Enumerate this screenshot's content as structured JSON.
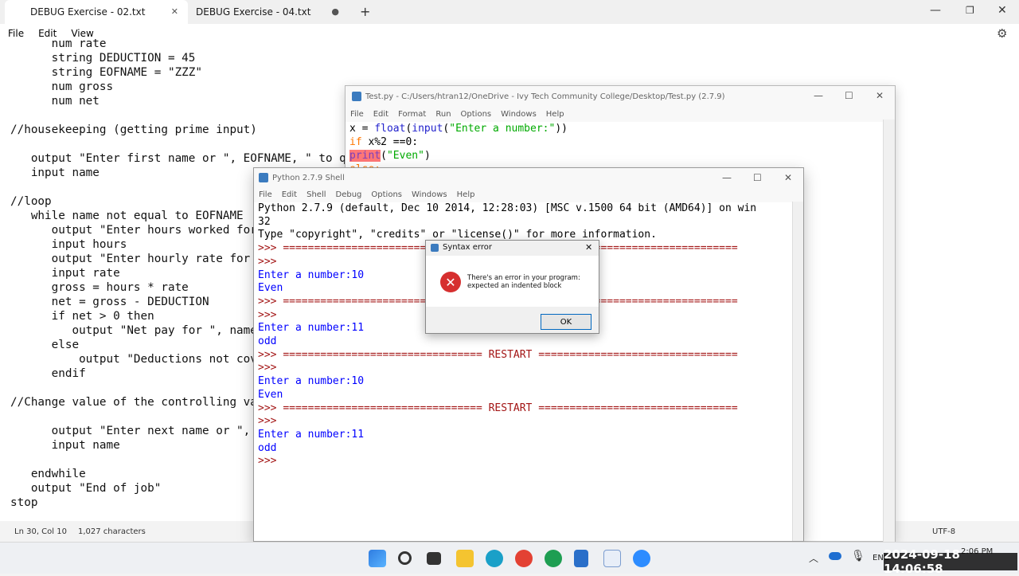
{
  "notepad": {
    "tabs": [
      {
        "label": "DEBUG Exercise - 02.txt"
      },
      {
        "label": "DEBUG Exercise - 04.txt"
      }
    ],
    "menu": [
      "File",
      "Edit",
      "View"
    ],
    "code": "      num rate\n      string DEDUCTION = 45\n      string EOFNAME = \"ZZZ\"\n      num gross\n      num net\n\n//housekeeping (getting prime input)\n\n   output \"Enter first name or \", EOFNAME, \" to q\n   input name\n\n//loop\n   while name not equal to EOFNAME\n      output \"Enter hours worked for\n      input hours\n      output \"Enter hourly rate for\n      input rate\n      gross = hours * rate\n      net = gross - DEDUCTION\n      if net > 0 then\n         output \"Net pay for \", name\n      else\n          output \"Deductions not cov\n      endif\n\n//Change value of the controlling va\n\n      output \"Enter next name or \",\n      input name\n\n   endwhile\n   output \"End of job\"\nstop",
    "status": {
      "position": "Ln 30, Col 10",
      "chars": "1,027 characters",
      "encoding": "UTF-8"
    }
  },
  "editor": {
    "title": "Test.py - C:/Users/htran12/OneDrive - Ivy Tech Community College/Desktop/Test.py (2.7.9)",
    "menu": [
      "File",
      "Edit",
      "Format",
      "Run",
      "Options",
      "Windows",
      "Help"
    ],
    "lines": {
      "l1a": "x = ",
      "l1b": "float",
      "l1c": "(",
      "l1d": "input",
      "l1e": "(",
      "l1f": "\"Enter a number:\"",
      "l1g": "))",
      "l2a": "if",
      "l2b": " x%2 ==0:",
      "l3a": "print",
      "l3b": "(",
      "l3c": "\"Even\"",
      "l3d": ")",
      "l4": "else:"
    }
  },
  "shell": {
    "title": "Python 2.7.9 Shell",
    "menu": [
      "File",
      "Edit",
      "Shell",
      "Debug",
      "Options",
      "Windows",
      "Help"
    ],
    "banner1": "Python 2.7.9 (default, Dec 10 2014, 12:28:03) [MSC v.1500 64 bit (AMD64)] on win",
    "banner2": "32",
    "banner3": "Type \"copyright\", \"credits\" or \"license()\" for more information.",
    "prompt": ">>> ",
    "restart": "================================ RESTART ================================",
    "input_label": "Enter a number:",
    "runs": [
      {
        "value": "10",
        "result": "Even"
      },
      {
        "value": "11",
        "result": "odd"
      },
      {
        "value": "10",
        "result": "Even"
      },
      {
        "value": "11",
        "result": "odd"
      }
    ]
  },
  "dialog": {
    "title": "Syntax error",
    "message1": "There's an error in your program:",
    "message2": "expected an indented block",
    "ok": "OK"
  },
  "taskbar": {
    "lang": "ENG",
    "time": "2:06 PM",
    "timestamp": "2024-09-18  14:06:58"
  }
}
